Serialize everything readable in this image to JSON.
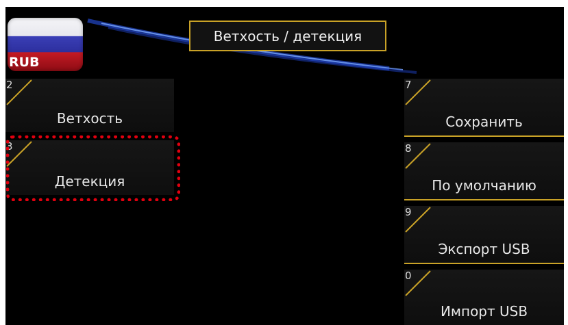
{
  "header": {
    "title": "Ветхость / детекция",
    "flag_label": "RUB"
  },
  "left_buttons": [
    {
      "number": "2",
      "label": "Ветхость"
    },
    {
      "number": "3",
      "label": "Детекция"
    }
  ],
  "right_buttons": [
    {
      "number": "7",
      "label": "Сохранить"
    },
    {
      "number": "8",
      "label": "По умолчанию"
    },
    {
      "number": "9",
      "label": "Экспорт USB"
    },
    {
      "number": "0",
      "label": "Импорт USB"
    }
  ],
  "colors": {
    "accent": "#c9a227",
    "highlight": "#e0000f",
    "background": "#000000"
  }
}
